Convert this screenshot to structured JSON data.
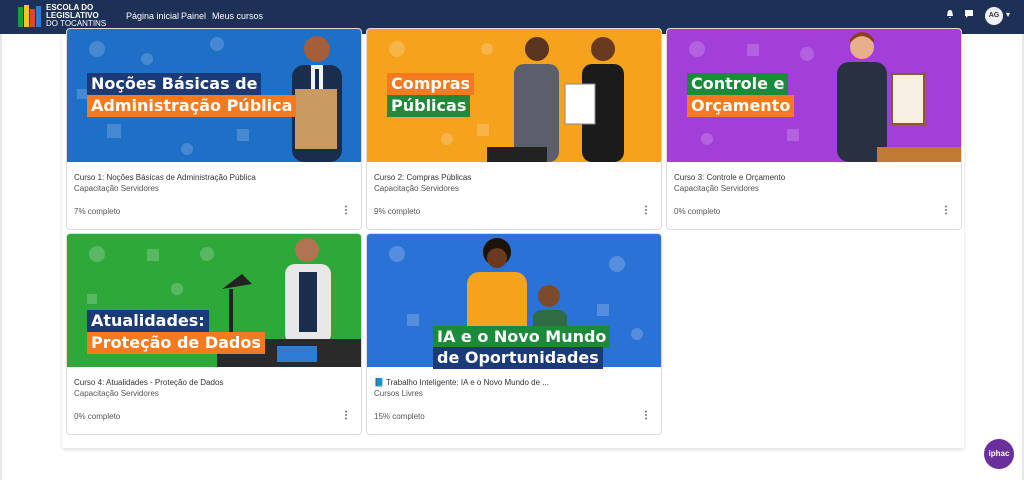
{
  "navbar": {
    "logo_line1": "ESCOLA DO",
    "logo_line2": "LEGISLATIVO",
    "logo_line3": "DO TOCANTINS",
    "items": [
      "Página inicial",
      "Painel",
      "Meus cursos"
    ],
    "active": "Meus cursos",
    "avatar_initials": "AG",
    "icons": [
      "bell-icon",
      "chat-icon",
      "chevron-down-icon"
    ]
  },
  "courses": [
    {
      "banner_lines": [
        "Noções Básicas de",
        "Administração Pública"
      ],
      "title": "Curso 1: Noções Básicas de Administração Pública",
      "category": "Capacitação Servidores",
      "progress": "7% completo",
      "bg": "#1e6fc6"
    },
    {
      "banner_lines": [
        "Compras",
        "Públicas"
      ],
      "title": "Curso 2: Compras Públicas",
      "category": "Capacitação Servidores",
      "progress": "9% completo",
      "bg": "#f5a21c"
    },
    {
      "banner_lines": [
        "Controle e",
        "Orçamento"
      ],
      "title": "Curso 3: Controle e Orçamento",
      "category": "Capacitação Servidores",
      "progress": "0% completo",
      "bg": "#a23fd8"
    },
    {
      "banner_lines": [
        "Atualidades:",
        "Proteção de Dados"
      ],
      "title": "Curso 4: Atualidades - Proteção de Dados",
      "category": "Capacitação Servidores",
      "progress": "0% completo",
      "bg": "#2fa83a"
    },
    {
      "banner_lines": [
        "IA e o Novo Mundo",
        "de Oportunidades"
      ],
      "title": "📘 Trabalho Inteligente: IA e o Novo Mundo de ...",
      "category": "Cursos Livres",
      "progress": "15% completo",
      "bg": "#2a72d6"
    }
  ],
  "fab_label": "iphac"
}
